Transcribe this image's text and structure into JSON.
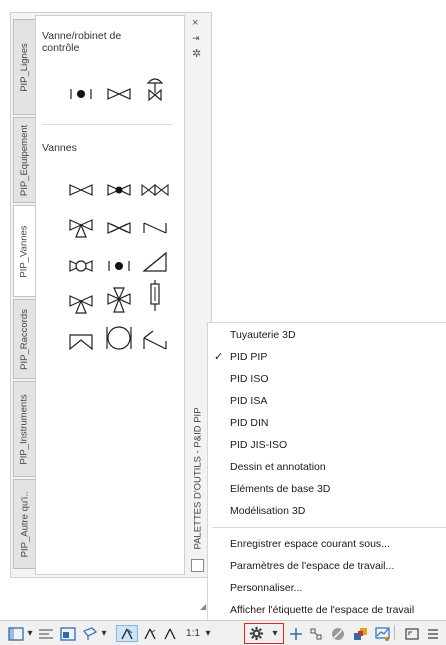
{
  "palette": {
    "tabs": [
      {
        "label": "PIP_Lignes",
        "active": false
      },
      {
        "label": "PIP_Equipement",
        "active": false
      },
      {
        "label": "PIP_Vannes",
        "active": true
      },
      {
        "label": "PIP_Raccords",
        "active": false
      },
      {
        "label": "PIP_Instruments",
        "active": false
      },
      {
        "label": "PIP_Autre qu'i..",
        "active": false
      }
    ],
    "sections": {
      "control_valve_title": "Vanne/robinet de\ncontrôle",
      "valves_title": "Vannes"
    },
    "strip_title": "PALETTES D'OUTILS - P&ID PIP",
    "close_symbol": "×",
    "autohide_symbol": "⇥",
    "props_symbol": "✲"
  },
  "menu": {
    "items": [
      {
        "label": "Tuyauterie 3D",
        "checked": false
      },
      {
        "label": "PID PIP",
        "checked": true
      },
      {
        "label": "PID ISO",
        "checked": false
      },
      {
        "label": "PID ISA",
        "checked": false
      },
      {
        "label": "PID DIN",
        "checked": false
      },
      {
        "label": "PID JIS-ISO",
        "checked": false
      },
      {
        "label": "Dessin et annotation",
        "checked": false
      },
      {
        "label": "Eléments de base 3D",
        "checked": false
      },
      {
        "label": "Modélisation 3D",
        "checked": false
      }
    ],
    "actions": [
      {
        "label": "Enregistrer espace courant sous..."
      },
      {
        "label": "Paramètres de l'espace de travail..."
      },
      {
        "label": "Personnaliser..."
      },
      {
        "label": "Afficher l'étiquette de l'espace de travail"
      }
    ],
    "check_mark": "✓"
  },
  "statusbar": {
    "scale_label": "1:1",
    "dropdown_arrow": "▾"
  }
}
